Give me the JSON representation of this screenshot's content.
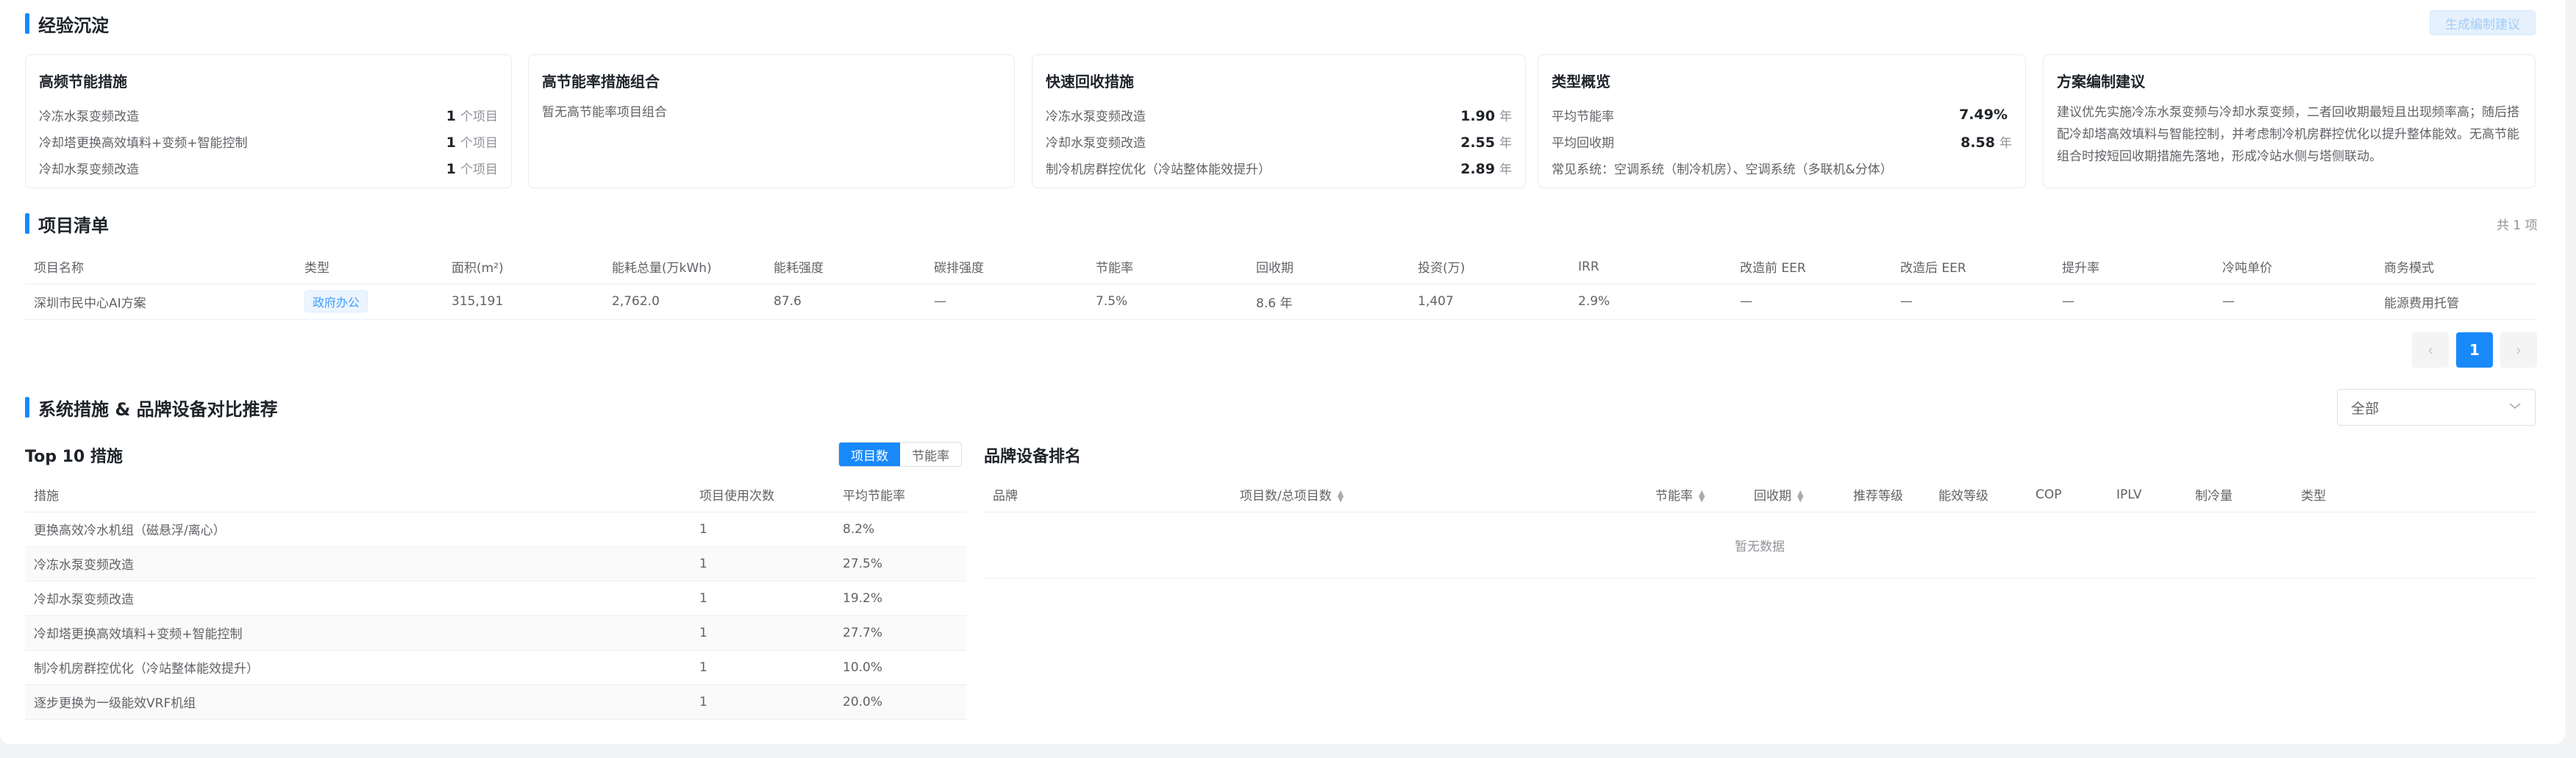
{
  "experience": {
    "title": "经验沉淀",
    "generate_button": "生成编制建议",
    "cards": {
      "frequent": {
        "title": "高频节能措施",
        "unit": "个项目",
        "rows": [
          {
            "label": "冷冻水泵变频改造",
            "value": "1"
          },
          {
            "label": "冷却塔更换高效填料+变频+智能控制",
            "value": "1"
          },
          {
            "label": "冷却水泵变频改造",
            "value": "1"
          }
        ]
      },
      "combo": {
        "title": "高节能率措施组合",
        "empty": "暂无高节能率项目组合"
      },
      "fast": {
        "title": "快速回收措施",
        "unit": "年",
        "rows": [
          {
            "label": "冷冻水泵变频改造",
            "value": "1.90"
          },
          {
            "label": "冷却水泵变频改造",
            "value": "2.55"
          },
          {
            "label": "制冷机房群控优化（冷站整体能效提升）",
            "value": "2.89"
          }
        ]
      },
      "overview": {
        "title": "类型概览",
        "rows": [
          {
            "label": "平均节能率",
            "value": "7.49%",
            "unit": ""
          },
          {
            "label": "平均回收期",
            "value": "8.58",
            "unit": "年"
          }
        ],
        "common": "常见系统：空调系统（制冷机房）、空调系统（多联机&分体）"
      },
      "advice": {
        "title": "方案编制建议",
        "text": "建议优先实施冷冻水泵变频与冷却水泵变频，二者回收期最短且出现频率高；随后搭配冷却塔高效填料与智能控制，并考虑制冷机房群控优化以提升整体能效。无高节能组合时按短回收期措施先落地，形成冷站水侧与塔侧联动。"
      }
    }
  },
  "projects": {
    "title": "项目清单",
    "total": "共 1 项",
    "headers": [
      "项目名称",
      "类型",
      "面积(m²)",
      "能耗总量(万kWh)",
      "能耗强度",
      "碳排强度",
      "节能率",
      "回收期",
      "投资(万)",
      "IRR",
      "改造前 EER",
      "改造后 EER",
      "提升率",
      "冷吨单价",
      "商务模式"
    ],
    "rows": [
      {
        "name": "深圳市民中心AI方案",
        "type": "政府办公",
        "area": "315,191",
        "energy": "2,762.0",
        "intensity": "87.6",
        "carbon": "—",
        "saving": "7.5%",
        "payback": "8.6 年",
        "invest": "1,407",
        "irr": "2.9%",
        "eer_before": "—",
        "eer_after": "—",
        "lift": "—",
        "ton_price": "—",
        "mode": "能源费用托管"
      }
    ],
    "pagination": {
      "prev": "‹",
      "current": "1",
      "next": "›"
    }
  },
  "compare": {
    "title": "系统措施 & 品牌设备对比推荐",
    "filter_value": "全部",
    "top10": {
      "title": "Top 10 措施",
      "toggle": [
        "项目数",
        "节能率"
      ],
      "headers": [
        "措施",
        "项目使用次数",
        "平均节能率"
      ],
      "rows": [
        {
          "name": "更换高效冷水机组（磁悬浮/离心）",
          "count": "1",
          "rate": "8.2%"
        },
        {
          "name": "冷冻水泵变频改造",
          "count": "1",
          "rate": "27.5%"
        },
        {
          "name": "冷却水泵变频改造",
          "count": "1",
          "rate": "19.2%"
        },
        {
          "name": "冷却塔更换高效填料+变频+智能控制",
          "count": "1",
          "rate": "27.7%"
        },
        {
          "name": "制冷机房群控优化（冷站整体能效提升）",
          "count": "1",
          "rate": "10.0%"
        },
        {
          "name": "逐步更换为一级能效VRF机组",
          "count": "1",
          "rate": "20.0%"
        }
      ]
    },
    "brand": {
      "title": "品牌设备排名",
      "headers": [
        "品牌",
        "项目数/总项目数",
        "节能率",
        "回收期",
        "推荐等级",
        "能效等级",
        "COP",
        "IPLV",
        "制冷量",
        "类型"
      ],
      "empty": "暂无数据"
    }
  },
  "colors": {
    "accent": "#1989fa",
    "tag_bg": "#ecf5ff",
    "tag_text": "#409eff"
  }
}
